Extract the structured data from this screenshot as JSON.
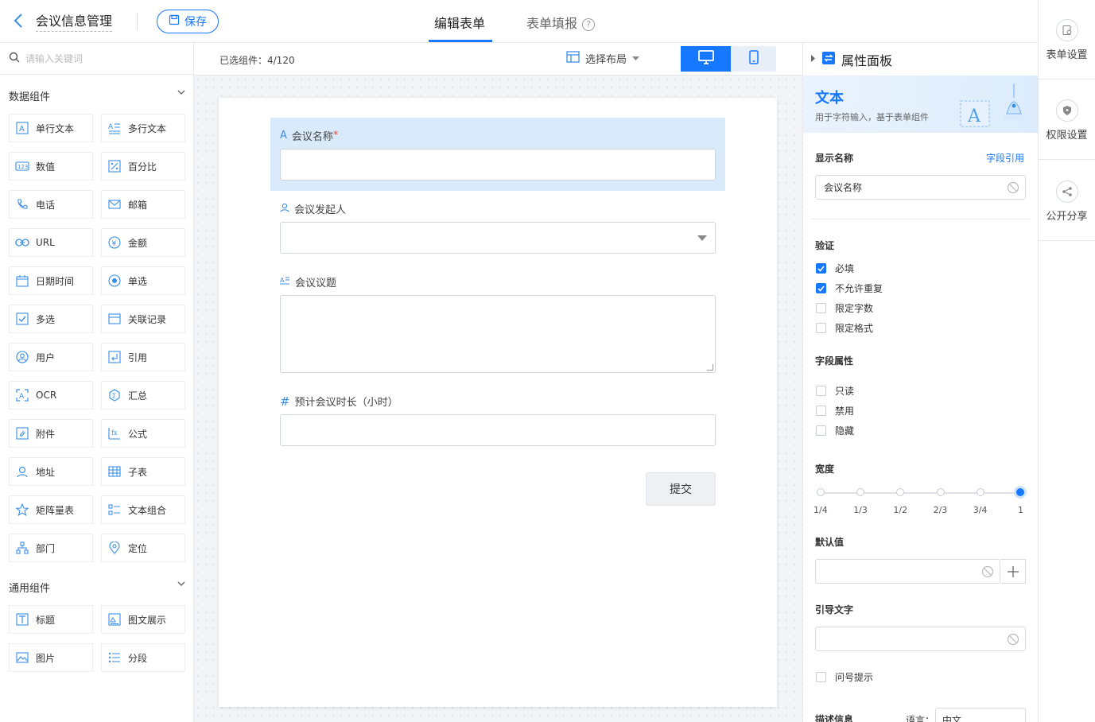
{
  "header": {
    "app_title": "会议信息管理",
    "save_label": "保存",
    "tabs": [
      {
        "label": "编辑表单",
        "active": true
      },
      {
        "label": "表单填报",
        "active": false
      }
    ],
    "help_glyph": "?"
  },
  "left_panel": {
    "search_placeholder": "请输入关键词",
    "groups": [
      {
        "title": "数据组件",
        "items": [
          {
            "label": "单行文本",
            "icon": "text-a-icon"
          },
          {
            "label": "多行文本",
            "icon": "multiline-icon"
          },
          {
            "label": "数值",
            "icon": "number-icon"
          },
          {
            "label": "百分比",
            "icon": "percent-icon"
          },
          {
            "label": "电话",
            "icon": "phone-icon"
          },
          {
            "label": "邮箱",
            "icon": "mail-icon"
          },
          {
            "label": "URL",
            "icon": "link-icon"
          },
          {
            "label": "金额",
            "icon": "yen-icon"
          },
          {
            "label": "日期时间",
            "icon": "calendar-icon"
          },
          {
            "label": "单选",
            "icon": "radio-icon"
          },
          {
            "label": "多选",
            "icon": "checkbox-icon"
          },
          {
            "label": "关联记录",
            "icon": "relation-icon"
          },
          {
            "label": "用户",
            "icon": "user-icon"
          },
          {
            "label": "引用",
            "icon": "quote-icon"
          },
          {
            "label": "OCR",
            "icon": "ocr-icon"
          },
          {
            "label": "汇总",
            "icon": "sum-icon"
          },
          {
            "label": "附件",
            "icon": "attachment-icon"
          },
          {
            "label": "公式",
            "icon": "formula-icon"
          },
          {
            "label": "地址",
            "icon": "location-pin-icon"
          },
          {
            "label": "子表",
            "icon": "subtable-icon"
          },
          {
            "label": "矩阵量表",
            "icon": "star-icon"
          },
          {
            "label": "文本组合",
            "icon": "text-combo-icon"
          },
          {
            "label": "部门",
            "icon": "org-chart-icon"
          },
          {
            "label": "定位",
            "icon": "map-marker-icon"
          }
        ]
      },
      {
        "title": "通用组件",
        "items": [
          {
            "label": "标题",
            "icon": "heading-icon"
          },
          {
            "label": "图文展示",
            "icon": "image-text-icon"
          },
          {
            "label": "图片",
            "icon": "image-icon"
          },
          {
            "label": "分段",
            "icon": "list-icon"
          }
        ]
      }
    ]
  },
  "toolbar": {
    "selected_count": "已选组件：4/120",
    "layout_label": "选择布局"
  },
  "form": {
    "fields": [
      {
        "label": "会议名称",
        "required_mark": "*",
        "type": "text"
      },
      {
        "label": "会议发起人",
        "type": "user-select"
      },
      {
        "label": "会议议题",
        "type": "textarea"
      },
      {
        "label": "预计会议时长（小时）",
        "type": "number"
      }
    ],
    "submit_label": "提交"
  },
  "properties": {
    "panel_title": "属性面板",
    "component_title": "文本",
    "component_desc": "用于字符输入，基于表单组件",
    "display_name_label": "显示名称",
    "field_ref_label": "字段引用",
    "display_name_value": "会议名称",
    "validation_label": "验证",
    "validation_options": [
      {
        "label": "必填",
        "checked": true
      },
      {
        "label": "不允许重复",
        "checked": true
      },
      {
        "label": "限定字数",
        "checked": false
      },
      {
        "label": "限定格式",
        "checked": false
      }
    ],
    "field_attr_label": "字段属性",
    "field_attr_options": [
      {
        "label": "只读",
        "checked": false
      },
      {
        "label": "禁用",
        "checked": false
      },
      {
        "label": "隐藏",
        "checked": false
      }
    ],
    "width_label": "宽度",
    "width_stops": [
      "1/4",
      "1/3",
      "1/2",
      "2/3",
      "3/4",
      "1"
    ],
    "width_selected": "1",
    "default_value_label": "默认值",
    "default_value": "",
    "placeholder_label": "引导文字",
    "placeholder_value": "",
    "tooltip_label": "问号提示",
    "tooltip_checked": false,
    "description_label": "描述信息",
    "language_label": "语言：",
    "language_value": "中文"
  },
  "rail": {
    "items": [
      {
        "label": "表单设置",
        "icon": "form-settings-icon"
      },
      {
        "label": "权限设置",
        "icon": "shield-icon"
      },
      {
        "label": "公开分享",
        "icon": "share-icon"
      }
    ]
  },
  "colors": {
    "accent": "#1677ff",
    "selected_field_bg": "#d9ebfb",
    "required": "#e34d4d"
  }
}
